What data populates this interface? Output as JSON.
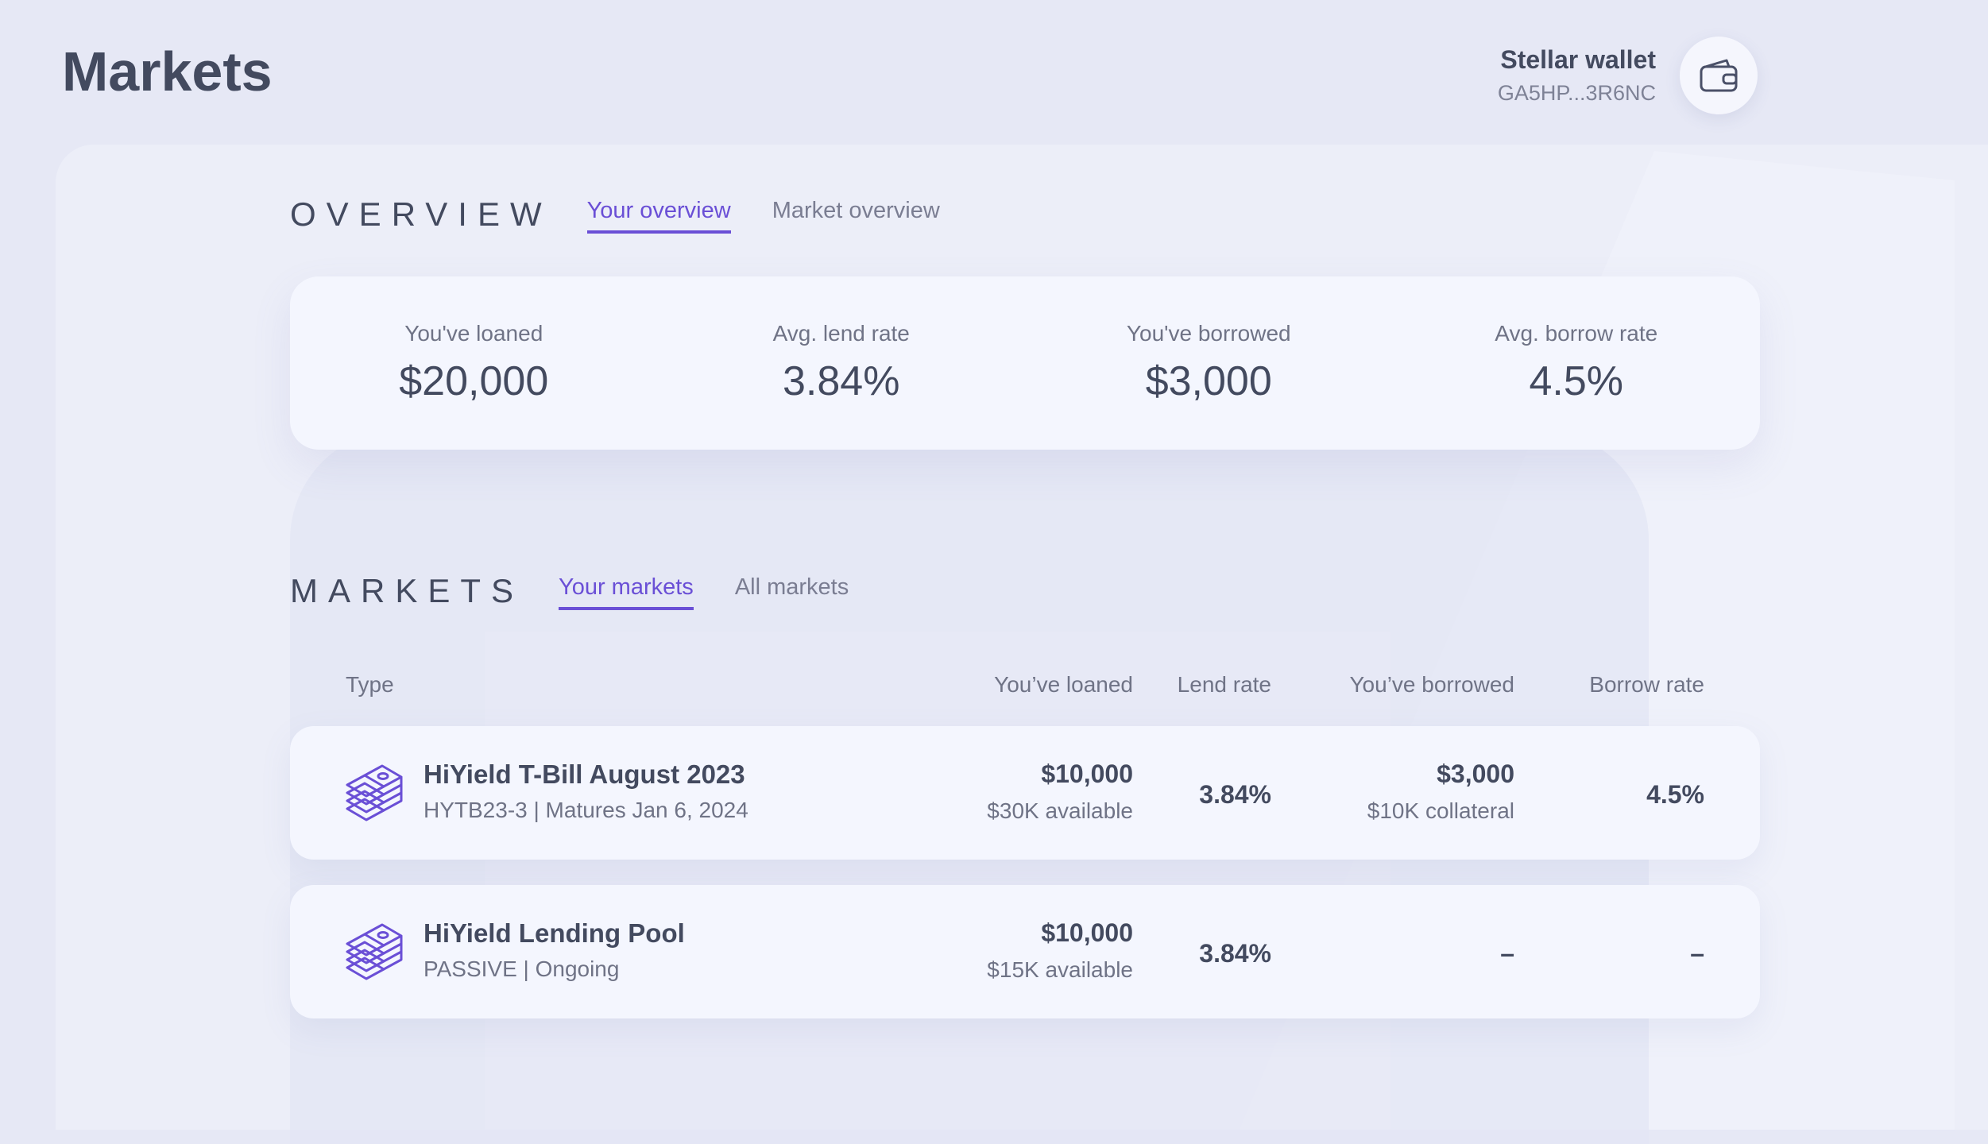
{
  "page": {
    "title": "Markets"
  },
  "wallet": {
    "name": "Stellar wallet",
    "address": "GA5HP...3R6NC",
    "icon": "wallet-icon"
  },
  "overview": {
    "title": "OVERVIEW",
    "tabs": [
      {
        "label": "Your overview",
        "active": true
      },
      {
        "label": "Market overview",
        "active": false
      }
    ],
    "stats": [
      {
        "label": "You've loaned",
        "value": "$20,000"
      },
      {
        "label": "Avg. lend rate",
        "value": "3.84%"
      },
      {
        "label": "You've borrowed",
        "value": "$3,000"
      },
      {
        "label": "Avg. borrow rate",
        "value": "4.5%"
      }
    ]
  },
  "markets": {
    "title": "MARKETS",
    "tabs": [
      {
        "label": "Your markets",
        "active": true
      },
      {
        "label": "All markets",
        "active": false
      }
    ],
    "columns": [
      "Type",
      "You’ve loaned",
      "Lend rate",
      "You’ve borrowed",
      "Borrow rate"
    ],
    "rows": [
      {
        "icon": "stacked-cash-icon",
        "name": "HiYield T-Bill August 2023",
        "subtitle": "HYTB23-3 | Matures Jan 6, 2024",
        "loaned": "$10,000",
        "loaned_sub": "$30K available",
        "lend_rate": "3.84%",
        "borrowed": "$3,000",
        "borrowed_sub": "$10K collateral",
        "borrow_rate": "4.5%"
      },
      {
        "icon": "stacked-cash-icon",
        "name": "HiYield Lending Pool",
        "subtitle": "PASSIVE | Ongoing",
        "loaned": "$10,000",
        "loaned_sub": "$15K available",
        "lend_rate": "3.84%",
        "borrowed": "–",
        "borrow_rate": "–"
      }
    ]
  },
  "colors": {
    "accent": "#6a4fd6",
    "text": "#434a5f",
    "muted": "#6f7386",
    "card": "#f4f6fe",
    "background": "#e6e8f5"
  }
}
